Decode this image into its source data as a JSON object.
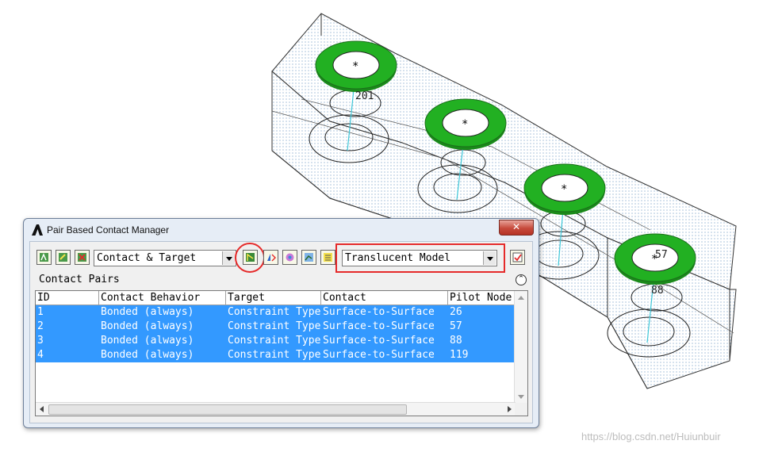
{
  "window": {
    "title": "Pair Based Contact Manager",
    "close_glyph": "✕"
  },
  "toolbar": {
    "view_select": {
      "value": "Contact & Target"
    },
    "display_select": {
      "value": "Translucent Model"
    }
  },
  "section": {
    "title": "Contact Pairs",
    "collapse_glyph": "⌃"
  },
  "table": {
    "headers": [
      "ID",
      "Contact Behavior",
      "Target",
      "Contact",
      "Pilot Node"
    ],
    "rows": [
      [
        "1",
        "Bonded (always)",
        "Constraint Type",
        "Surface-to-Surface",
        "26"
      ],
      [
        "2",
        "Bonded (always)",
        "Constraint Type",
        "Surface-to-Surface",
        "57"
      ],
      [
        "3",
        "Bonded (always)",
        "Constraint Type",
        "Surface-to-Surface",
        "88"
      ],
      [
        "4",
        "Bonded (always)",
        "Constraint Type",
        "Surface-to-Surface",
        "119"
      ]
    ]
  },
  "model": {
    "labels": [
      "201",
      "57",
      "88"
    ]
  },
  "watermark": "https://blog.csdn.net/Huiunbuir",
  "colors": {
    "selection": "#3399ff",
    "contact_ring": "#22b022",
    "highlight": "#e52a2a",
    "pilot_line": "#3ec7d8"
  }
}
